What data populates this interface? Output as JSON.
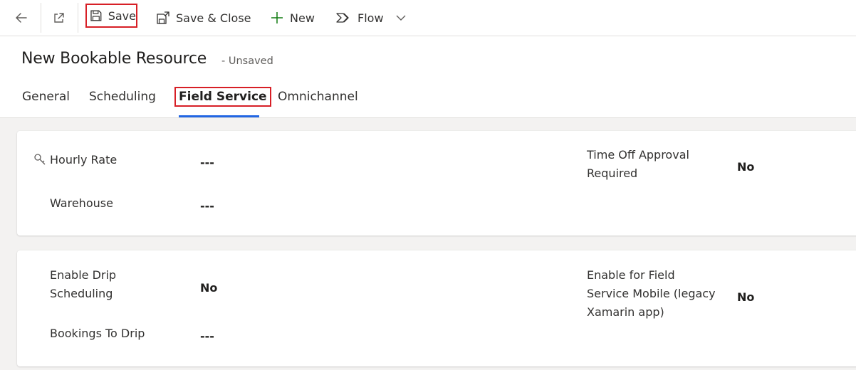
{
  "commandbar": {
    "back_icon": "arrow-left-icon",
    "popout_icon": "open-in-new-window-icon",
    "save_label": "Save",
    "save_close_label": "Save & Close",
    "new_label": "New",
    "flow_label": "Flow",
    "highlight_color": "#d71f26"
  },
  "header": {
    "title": "New Bookable Resource",
    "status": "- Unsaved",
    "tabs": [
      {
        "label": "General"
      },
      {
        "label": "Scheduling"
      },
      {
        "label": "Field Service",
        "active": true
      },
      {
        "label": "Omnichannel"
      }
    ],
    "active_tab_color": "#2266e3"
  },
  "section1": {
    "hourly_rate_label": "Hourly Rate",
    "hourly_rate_value": "---",
    "warehouse_label": "Warehouse",
    "warehouse_value": "---",
    "time_off_label_line1": "Time Off Approval",
    "time_off_label_line2": "Required",
    "time_off_value": "No"
  },
  "section2": {
    "drip_label_line1": "Enable Drip",
    "drip_label_line2": "Scheduling",
    "drip_value": "No",
    "bookings_label": "Bookings To Drip",
    "bookings_value": "---",
    "fsm_label_line1": "Enable for Field",
    "fsm_label_line2": "Service Mobile (legacy",
    "fsm_label_line3": "Xamarin app)",
    "fsm_value": "No"
  }
}
